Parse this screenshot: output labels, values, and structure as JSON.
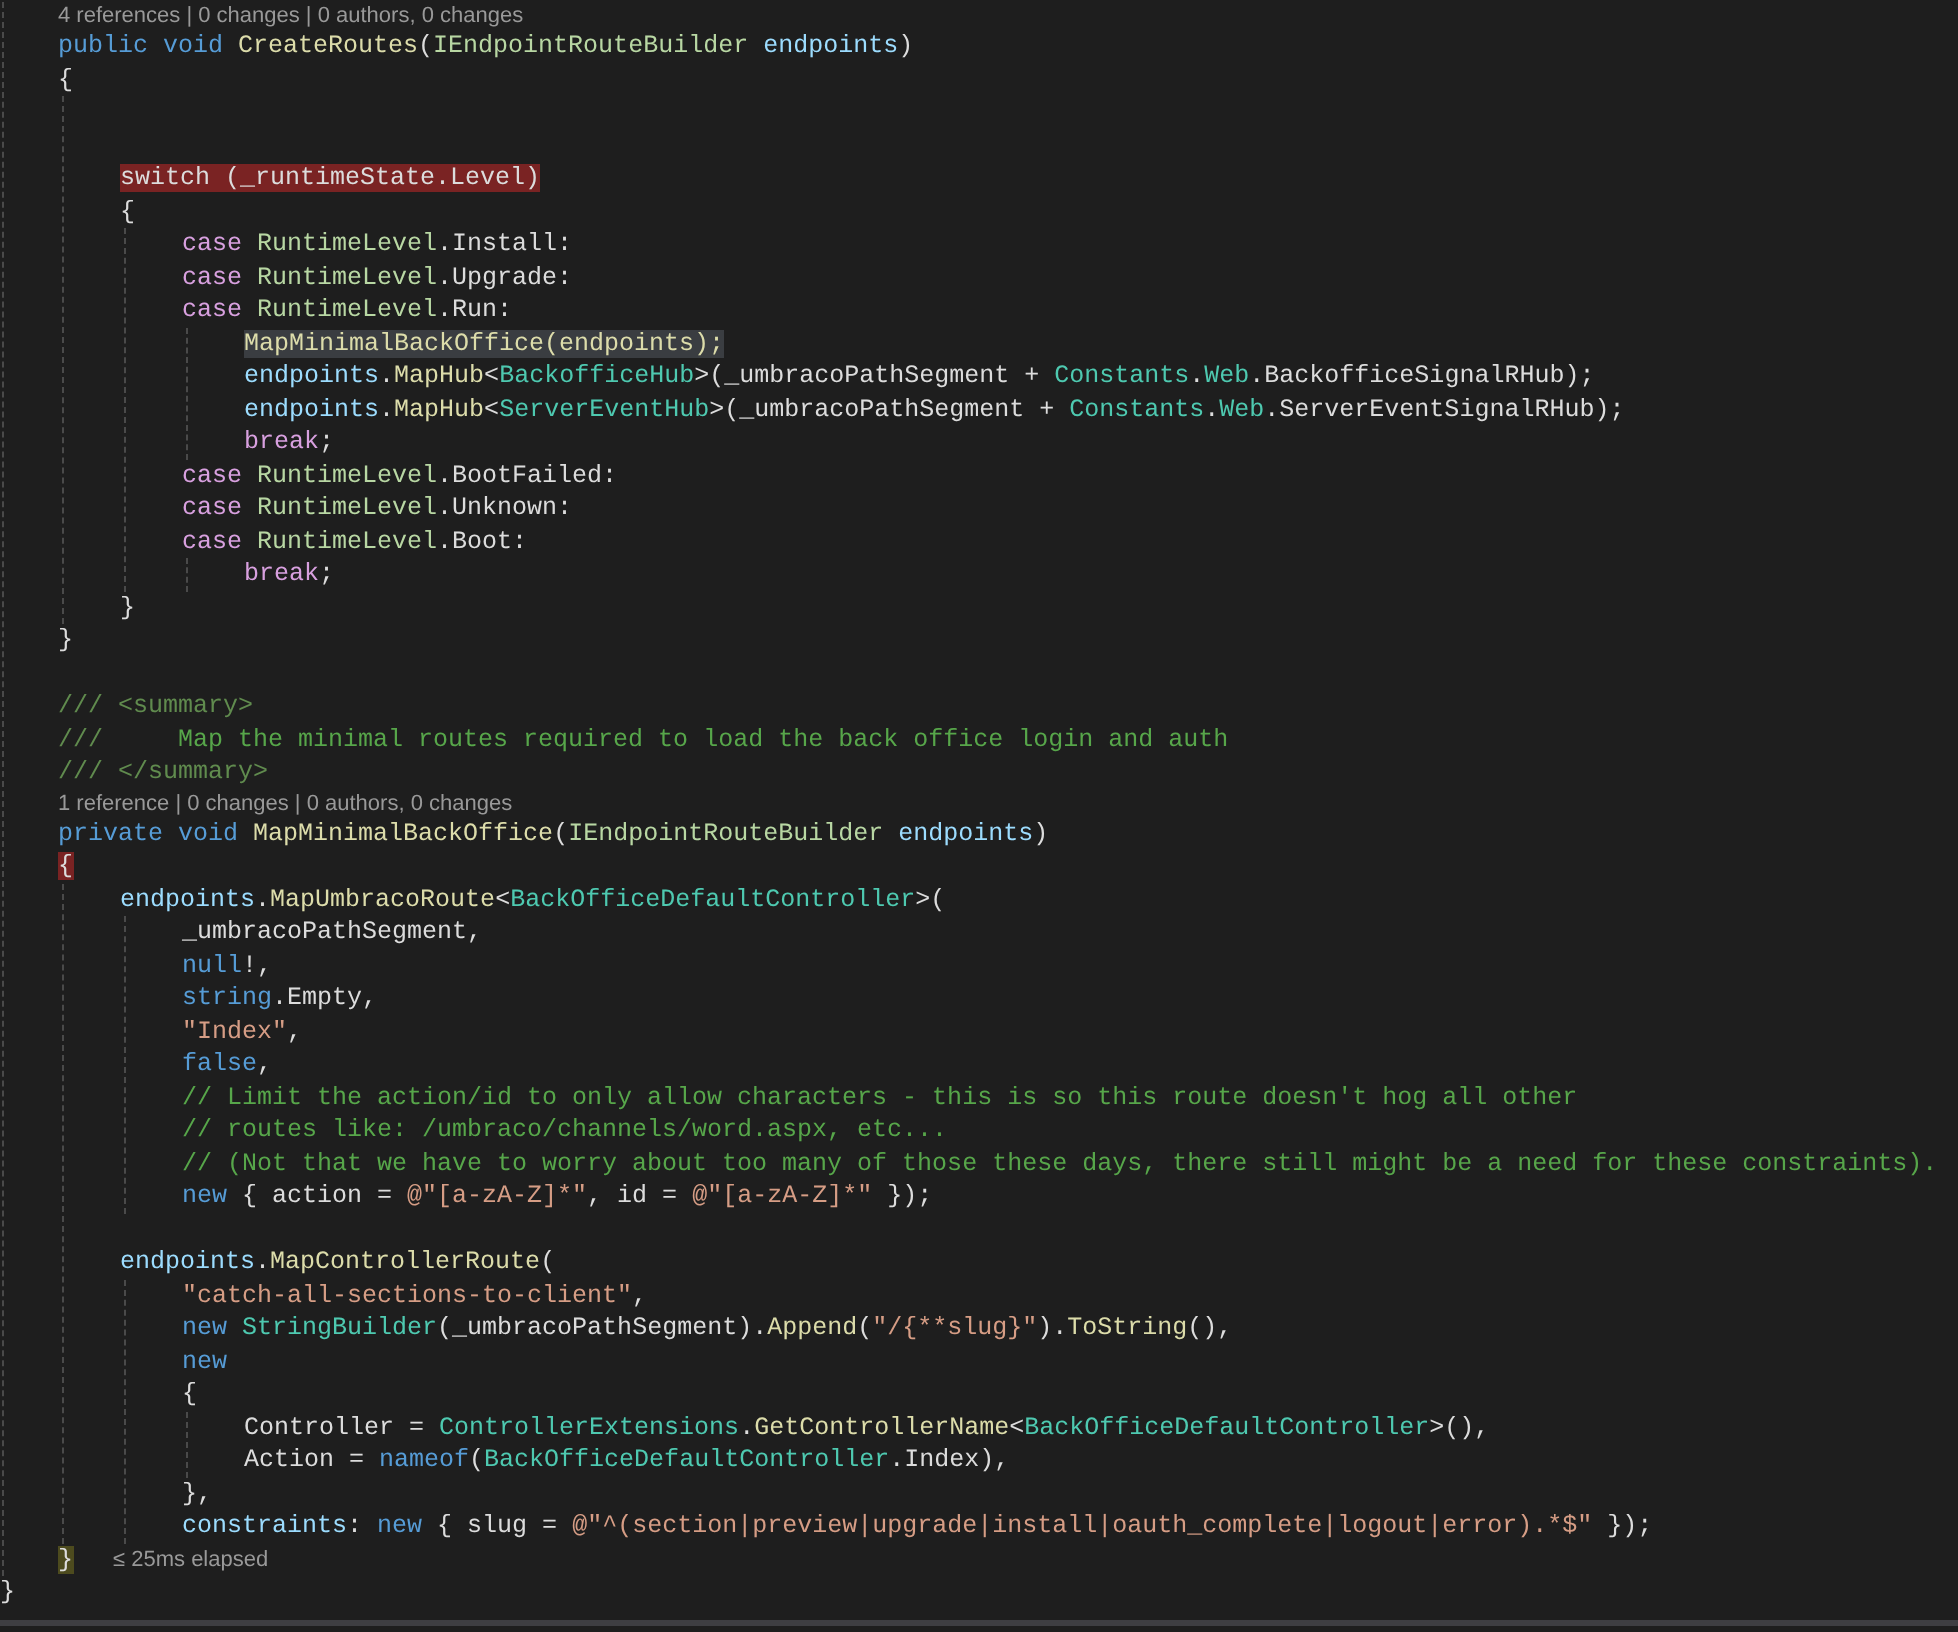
{
  "editor": {
    "class_body": [
      {
        "kind": "codelens",
        "text": "4 references | 0 changes | 0 authors, 0 changes"
      },
      {
        "kind": "code",
        "tokens": [
          {
            "kind": "kw",
            "text": "public void "
          },
          {
            "kind": "method",
            "text": "CreateRoutes"
          },
          {
            "kind": "plain",
            "text": "("
          },
          {
            "kind": "iface",
            "text": "IEndpointRouteBuilder "
          },
          {
            "kind": "param",
            "text": "endpoints"
          },
          {
            "kind": "plain",
            "text": ")"
          }
        ]
      },
      {
        "kind": "code",
        "tokens": [
          {
            "kind": "plain",
            "text": "{"
          }
        ],
        "children": [
          {
            "kind": "blank"
          },
          {
            "kind": "blank"
          },
          {
            "kind": "code",
            "tokens": [
              {
                "kind": "plain",
                "text": "switch (_runtimeState.Level)",
                "color": "#7a2323"
              }
            ]
          },
          {
            "kind": "code",
            "tokens": [
              {
                "kind": "plain",
                "text": "{"
              }
            ],
            "children": [
              {
                "kind": "code",
                "tokens": [
                  {
                    "kind": "ctl",
                    "text": "case "
                  },
                  {
                    "kind": "enum",
                    "text": "RuntimeLevel"
                  },
                  {
                    "kind": "plain",
                    "text": ".Install:"
                  }
                ]
              },
              {
                "kind": "code",
                "tokens": [
                  {
                    "kind": "ctl",
                    "text": "case "
                  },
                  {
                    "kind": "enum",
                    "text": "RuntimeLevel"
                  },
                  {
                    "kind": "plain",
                    "text": ".Upgrade:"
                  }
                ]
              },
              {
                "kind": "code",
                "tokens": [
                  {
                    "kind": "ctl",
                    "text": "case "
                  },
                  {
                    "kind": "enum",
                    "text": "RuntimeLevel"
                  },
                  {
                    "kind": "plain",
                    "text": ".Run:"
                  }
                ],
                "children": [
                  {
                    "kind": "code",
                    "tokens": [
                      {
                        "kind": "method",
                        "text": "MapMinimalBackOffice(endpoints);",
                        "color": "#3a3d41"
                      }
                    ]
                  },
                  {
                    "kind": "code",
                    "tokens": [
                      {
                        "kind": "param",
                        "text": "endpoints"
                      },
                      {
                        "kind": "plain",
                        "text": "."
                      },
                      {
                        "kind": "method",
                        "text": "MapHub"
                      },
                      {
                        "kind": "plain",
                        "text": "<"
                      },
                      {
                        "kind": "type",
                        "text": "BackofficeHub"
                      },
                      {
                        "kind": "plain",
                        "text": ">(_umbracoPathSegment + "
                      },
                      {
                        "kind": "type",
                        "text": "Constants"
                      },
                      {
                        "kind": "plain",
                        "text": "."
                      },
                      {
                        "kind": "type",
                        "text": "Web"
                      },
                      {
                        "kind": "plain",
                        "text": ".BackofficeSignalRHub);"
                      }
                    ]
                  },
                  {
                    "kind": "code",
                    "tokens": [
                      {
                        "kind": "param",
                        "text": "endpoints"
                      },
                      {
                        "kind": "plain",
                        "text": "."
                      },
                      {
                        "kind": "method",
                        "text": "MapHub"
                      },
                      {
                        "kind": "plain",
                        "text": "<"
                      },
                      {
                        "kind": "type",
                        "text": "ServerEventHub"
                      },
                      {
                        "kind": "plain",
                        "text": ">(_umbracoPathSegment + "
                      },
                      {
                        "kind": "type",
                        "text": "Constants"
                      },
                      {
                        "kind": "plain",
                        "text": "."
                      },
                      {
                        "kind": "type",
                        "text": "Web"
                      },
                      {
                        "kind": "plain",
                        "text": ".ServerEventSignalRHub);"
                      }
                    ]
                  },
                  {
                    "kind": "code",
                    "tokens": [
                      {
                        "kind": "ctl",
                        "text": "break"
                      },
                      {
                        "kind": "plain",
                        "text": ";"
                      }
                    ]
                  }
                ]
              },
              {
                "kind": "code",
                "tokens": [
                  {
                    "kind": "ctl",
                    "text": "case "
                  },
                  {
                    "kind": "enum",
                    "text": "RuntimeLevel"
                  },
                  {
                    "kind": "plain",
                    "text": ".BootFailed:"
                  }
                ]
              },
              {
                "kind": "code",
                "tokens": [
                  {
                    "kind": "ctl",
                    "text": "case "
                  },
                  {
                    "kind": "enum",
                    "text": "RuntimeLevel"
                  },
                  {
                    "kind": "plain",
                    "text": ".Unknown:"
                  }
                ]
              },
              {
                "kind": "code",
                "tokens": [
                  {
                    "kind": "ctl",
                    "text": "case "
                  },
                  {
                    "kind": "enum",
                    "text": "RuntimeLevel"
                  },
                  {
                    "kind": "plain",
                    "text": ".Boot:"
                  }
                ],
                "children": [
                  {
                    "kind": "code",
                    "tokens": [
                      {
                        "kind": "ctl",
                        "text": "break"
                      },
                      {
                        "kind": "plain",
                        "text": ";"
                      }
                    ]
                  }
                ]
              }
            ]
          },
          {
            "kind": "code",
            "tokens": [
              {
                "kind": "plain",
                "text": "}"
              }
            ]
          }
        ]
      },
      {
        "kind": "code",
        "tokens": [
          {
            "kind": "plain",
            "text": "}"
          }
        ]
      },
      {
        "kind": "blank"
      },
      {
        "kind": "code",
        "tokens": [
          {
            "kind": "doc",
            "text": "/// <summary>"
          }
        ]
      },
      {
        "kind": "code",
        "tokens": [
          {
            "kind": "doc",
            "text": "///"
          },
          {
            "kind": "com",
            "text": "     Map the minimal routes required to load the back office login and auth"
          }
        ]
      },
      {
        "kind": "code",
        "tokens": [
          {
            "kind": "doc",
            "text": "/// </summary>"
          }
        ]
      },
      {
        "kind": "codelens",
        "text": "1 reference | 0 changes | 0 authors, 0 changes"
      },
      {
        "kind": "code",
        "tokens": [
          {
            "kind": "kw",
            "text": "private void "
          },
          {
            "kind": "method",
            "text": "MapMinimalBackOffice"
          },
          {
            "kind": "plain",
            "text": "("
          },
          {
            "kind": "iface",
            "text": "IEndpointRouteBuilder "
          },
          {
            "kind": "param",
            "text": "endpoints"
          },
          {
            "kind": "plain",
            "text": ")"
          }
        ]
      },
      {
        "kind": "code",
        "tokens": [
          {
            "kind": "plain",
            "text": "{",
            "color": "#7a2323"
          }
        ],
        "children": [
          {
            "kind": "code",
            "tokens": [
              {
                "kind": "param",
                "text": "endpoints"
              },
              {
                "kind": "plain",
                "text": "."
              },
              {
                "kind": "method",
                "text": "MapUmbracoRoute"
              },
              {
                "kind": "plain",
                "text": "<"
              },
              {
                "kind": "type",
                "text": "BackOfficeDefaultController"
              },
              {
                "kind": "plain",
                "text": ">("
              }
            ],
            "children": [
              {
                "kind": "code",
                "tokens": [
                  {
                    "kind": "plain",
                    "text": "_umbracoPathSegment,"
                  }
                ]
              },
              {
                "kind": "code",
                "tokens": [
                  {
                    "kind": "kw",
                    "text": "null"
                  },
                  {
                    "kind": "plain",
                    "text": "!,"
                  }
                ]
              },
              {
                "kind": "code",
                "tokens": [
                  {
                    "kind": "kw",
                    "text": "string"
                  },
                  {
                    "kind": "plain",
                    "text": ".Empty,"
                  }
                ]
              },
              {
                "kind": "code",
                "tokens": [
                  {
                    "kind": "str",
                    "text": "\"Index\""
                  },
                  {
                    "kind": "plain",
                    "text": ","
                  }
                ]
              },
              {
                "kind": "code",
                "tokens": [
                  {
                    "kind": "kw",
                    "text": "false"
                  },
                  {
                    "kind": "plain",
                    "text": ","
                  }
                ]
              },
              {
                "kind": "code",
                "tokens": [
                  {
                    "kind": "com",
                    "text": "// Limit the action/id to only allow characters - this is so this route doesn't hog all other"
                  }
                ]
              },
              {
                "kind": "code",
                "tokens": [
                  {
                    "kind": "com",
                    "text": "// routes like: /umbraco/channels/word.aspx, etc..."
                  }
                ]
              },
              {
                "kind": "code",
                "tokens": [
                  {
                    "kind": "com",
                    "text": "// (Not that we have to worry about too many of those these days, there still might be a need for these constraints)."
                  }
                ]
              },
              {
                "kind": "code",
                "tokens": [
                  {
                    "kind": "kw",
                    "text": "new"
                  },
                  {
                    "kind": "plain",
                    "text": " { action = "
                  },
                  {
                    "kind": "str",
                    "text": "@\"[a-zA-Z]*\""
                  },
                  {
                    "kind": "plain",
                    "text": ", id = "
                  },
                  {
                    "kind": "str",
                    "text": "@\"[a-zA-Z]*\""
                  },
                  {
                    "kind": "plain",
                    "text": " });"
                  }
                ]
              }
            ]
          },
          {
            "kind": "blank"
          },
          {
            "kind": "code",
            "tokens": [
              {
                "kind": "param",
                "text": "endpoints"
              },
              {
                "kind": "plain",
                "text": "."
              },
              {
                "kind": "method",
                "text": "MapControllerRoute"
              },
              {
                "kind": "plain",
                "text": "("
              }
            ],
            "children": [
              {
                "kind": "code",
                "tokens": [
                  {
                    "kind": "str",
                    "text": "\"catch-all-sections-to-client\""
                  },
                  {
                    "kind": "plain",
                    "text": ","
                  }
                ]
              },
              {
                "kind": "code",
                "tokens": [
                  {
                    "kind": "kw",
                    "text": "new "
                  },
                  {
                    "kind": "type",
                    "text": "StringBuilder"
                  },
                  {
                    "kind": "plain",
                    "text": "(_umbracoPathSegment)."
                  },
                  {
                    "kind": "method",
                    "text": "Append"
                  },
                  {
                    "kind": "plain",
                    "text": "("
                  },
                  {
                    "kind": "str",
                    "text": "\"/{**slug}\""
                  },
                  {
                    "kind": "plain",
                    "text": ")."
                  },
                  {
                    "kind": "method",
                    "text": "ToString"
                  },
                  {
                    "kind": "plain",
                    "text": "(),"
                  }
                ]
              },
              {
                "kind": "code",
                "tokens": [
                  {
                    "kind": "kw",
                    "text": "new"
                  }
                ]
              },
              {
                "kind": "code",
                "tokens": [
                  {
                    "kind": "plain",
                    "text": "{"
                  }
                ],
                "children": [
                  {
                    "kind": "code",
                    "tokens": [
                      {
                        "kind": "plain",
                        "text": "Controller = "
                      },
                      {
                        "kind": "type",
                        "text": "ControllerExtensions"
                      },
                      {
                        "kind": "plain",
                        "text": "."
                      },
                      {
                        "kind": "method",
                        "text": "GetControllerName"
                      },
                      {
                        "kind": "plain",
                        "text": "<"
                      },
                      {
                        "kind": "type",
                        "text": "BackOfficeDefaultController"
                      },
                      {
                        "kind": "plain",
                        "text": ">(),"
                      }
                    ]
                  },
                  {
                    "kind": "code",
                    "tokens": [
                      {
                        "kind": "plain",
                        "text": "Action = "
                      },
                      {
                        "kind": "kw",
                        "text": "nameof"
                      },
                      {
                        "kind": "plain",
                        "text": "("
                      },
                      {
                        "kind": "type",
                        "text": "BackOfficeDefaultController"
                      },
                      {
                        "kind": "plain",
                        "text": ".Index),"
                      }
                    ]
                  }
                ]
              },
              {
                "kind": "code",
                "tokens": [
                  {
                    "kind": "plain",
                    "text": "},"
                  }
                ]
              },
              {
                "kind": "code",
                "tokens": [
                  {
                    "kind": "param",
                    "text": "constraints"
                  },
                  {
                    "kind": "plain",
                    "text": ": "
                  },
                  {
                    "kind": "kw",
                    "text": "new"
                  },
                  {
                    "kind": "plain",
                    "text": " { slug = "
                  },
                  {
                    "kind": "str",
                    "text": "@\"^(section|preview|upgrade|install|oauth_complete|logout|error).*$\""
                  },
                  {
                    "kind": "plain",
                    "text": " });"
                  }
                ]
              }
            ]
          }
        ]
      },
      {
        "kind": "code",
        "tokens": [
          {
            "kind": "plain",
            "text": "}",
            "color": "#4d4b1e"
          }
        ],
        "hint": "≤ 25ms elapsed"
      }
    ],
    "class_close": {
      "kind": "code",
      "tokens": [
        {
          "kind": "plain",
          "text": "}"
        }
      ]
    }
  }
}
